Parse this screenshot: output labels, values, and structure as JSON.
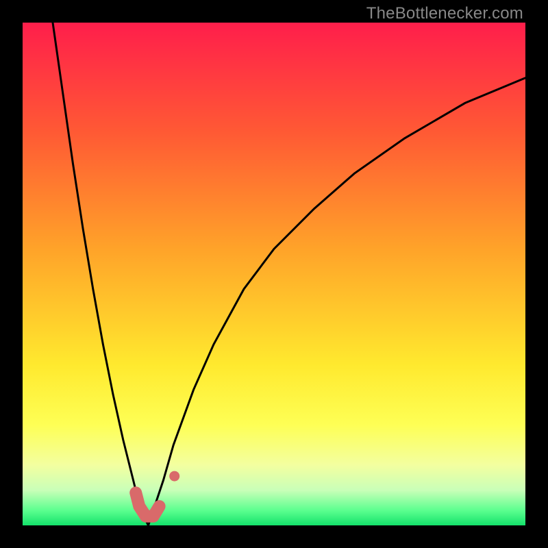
{
  "watermark": {
    "text": "TheBottlenecker.com"
  },
  "chart_data": {
    "type": "line",
    "title": "",
    "xlabel": "",
    "ylabel": "",
    "xlim": [
      0,
      100
    ],
    "ylim": [
      0,
      100
    ],
    "optimum_x": 25,
    "gradient_stops": [
      {
        "pct": 0,
        "color": "#ff1e4b"
      },
      {
        "pct": 22,
        "color": "#ff5a34"
      },
      {
        "pct": 45,
        "color": "#ffa329"
      },
      {
        "pct": 68,
        "color": "#ffe92e"
      },
      {
        "pct": 80,
        "color": "#feff55"
      },
      {
        "pct": 88,
        "color": "#f3ffa0"
      },
      {
        "pct": 93,
        "color": "#c9ffb8"
      },
      {
        "pct": 97,
        "color": "#5cff8f"
      },
      {
        "pct": 100,
        "color": "#14e26b"
      }
    ],
    "series": [
      {
        "name": "left_curve",
        "x": [
          6,
          8,
          10,
          12,
          14,
          16,
          18,
          20,
          22,
          23,
          24,
          25
        ],
        "y": [
          100,
          86,
          72,
          59,
          47,
          36,
          26,
          17,
          9,
          5,
          2,
          0
        ]
      },
      {
        "name": "right_curve",
        "x": [
          25,
          26,
          28,
          30,
          34,
          38,
          44,
          50,
          58,
          66,
          76,
          88,
          100
        ],
        "y": [
          0,
          3,
          9,
          16,
          27,
          36,
          47,
          55,
          63,
          70,
          77,
          84,
          89
        ]
      }
    ],
    "highlight_segment": {
      "color": "#d96a6a",
      "stroke_width_px": 18,
      "points_xy": [
        [
          22.5,
          6.5
        ],
        [
          23.2,
          3.8
        ],
        [
          24.5,
          1.8
        ],
        [
          26.0,
          1.8
        ],
        [
          27.2,
          3.8
        ],
        [
          28.0,
          6.3
        ],
        [
          30.2,
          9.8
        ]
      ]
    }
  }
}
